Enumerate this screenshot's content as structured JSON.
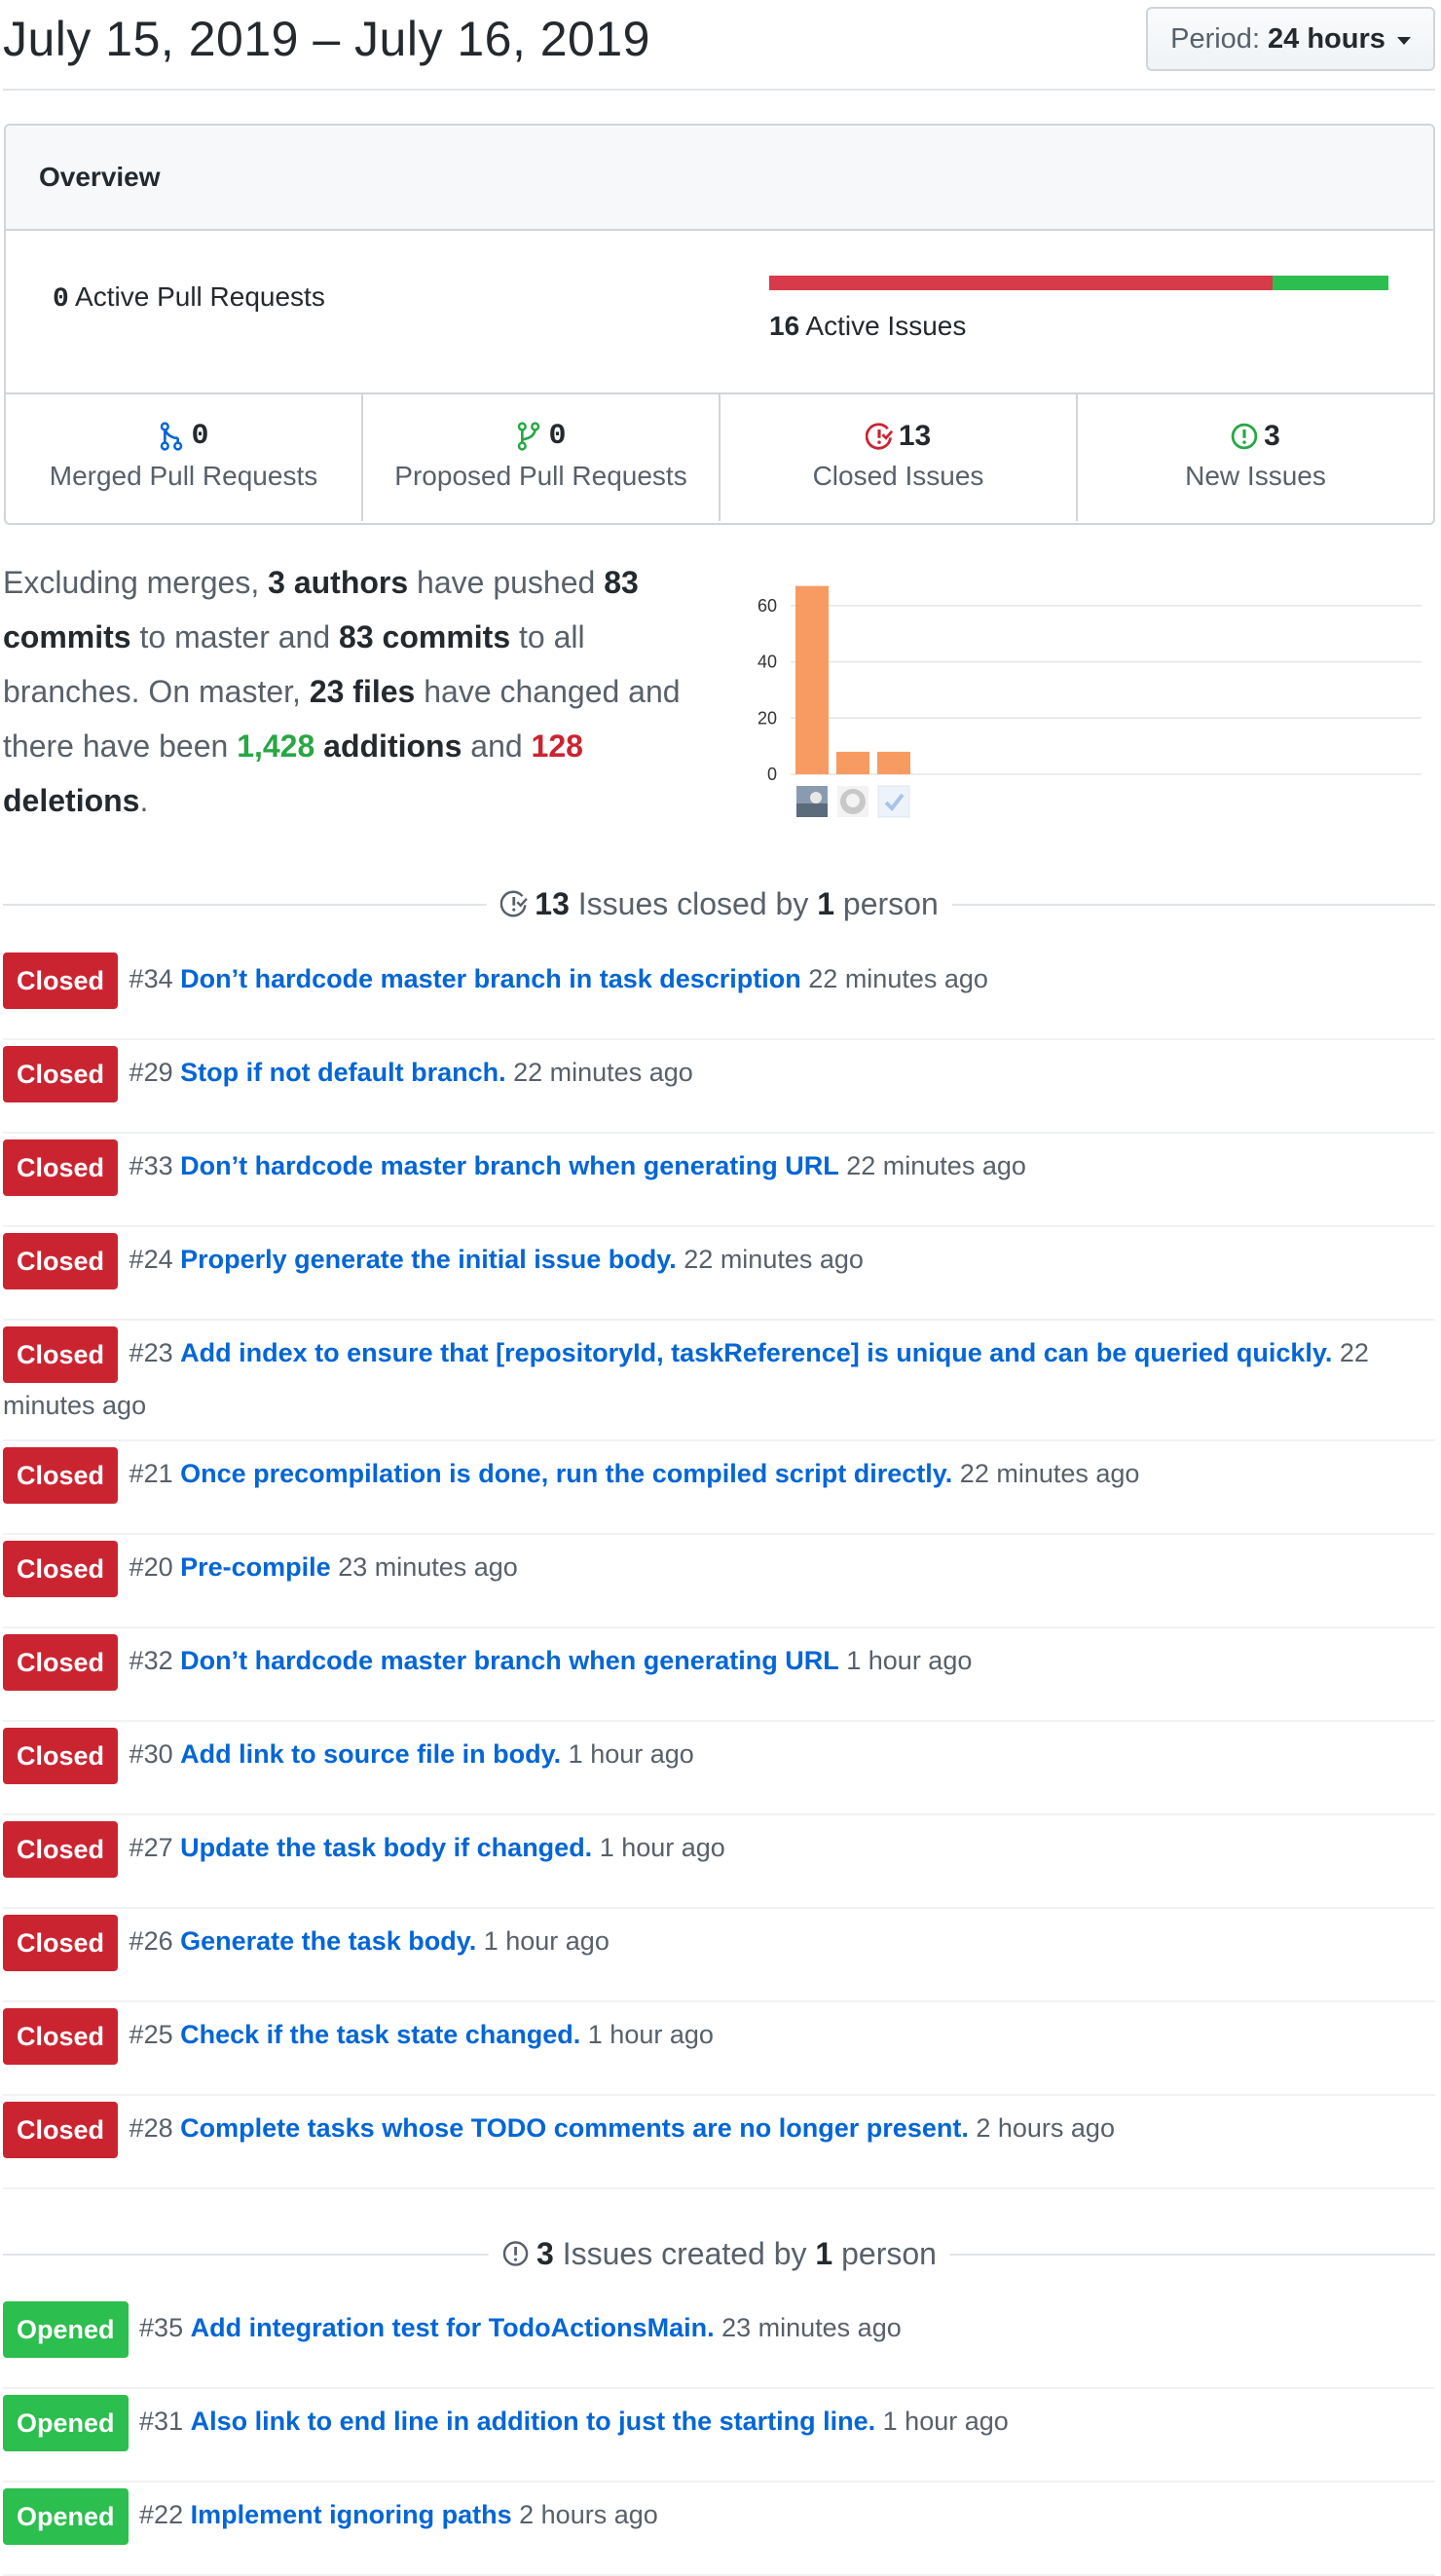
{
  "header": {
    "title": "July 15, 2019 – July 16, 2019",
    "period_label": "Period:",
    "period_value": "24 hours"
  },
  "overview": {
    "title": "Overview",
    "active_prs": {
      "count": "0",
      "label": "Active Pull Requests"
    },
    "active_issues": {
      "count": "16",
      "label": "Active Issues",
      "closed_fraction": 0.8125
    },
    "stats": [
      {
        "count": "0",
        "label": "Merged Pull Requests",
        "icon": "merged-pr-icon",
        "color": "#0366d6"
      },
      {
        "count": "0",
        "label": "Proposed Pull Requests",
        "icon": "proposed-pr-icon",
        "color": "#28a745"
      },
      {
        "count": "13",
        "label": "Closed Issues",
        "icon": "closed-issue-icon",
        "color": "#cb2431"
      },
      {
        "count": "3",
        "label": "New Issues",
        "icon": "new-issue-icon",
        "color": "#28a745"
      }
    ]
  },
  "summary": {
    "p1": "Excluding merges, ",
    "authors": "3 authors",
    "p2": " have pushed ",
    "commits_master": "83 commits",
    "p3": " to master and ",
    "commits_all": "83 commits",
    "p4": " to all branches. On master, ",
    "files": "23 files",
    "p5": " have changed and there have been ",
    "additions_num": "1,428",
    "additions_word": "additions",
    "p6": " and ",
    "deletions_num": "128",
    "deletions_word": "deletions",
    "p7": "."
  },
  "chart_data": {
    "type": "bar",
    "categories": [
      "author-1",
      "author-2",
      "author-3"
    ],
    "values": [
      67,
      8,
      8
    ],
    "yticks": [
      "0",
      "20",
      "40",
      "60"
    ],
    "ylim": [
      0,
      70
    ],
    "colors": {
      "bar": "#f89b62"
    },
    "x_tick_icons": [
      "avatar-photo-icon",
      "github-octocat-icon",
      "checkmark-icon"
    ]
  },
  "closed_section": {
    "count": "13",
    "text1": " Issues closed by ",
    "people": "1",
    "text2": " person"
  },
  "closed_issues": [
    {
      "badge": "Closed",
      "number": "#34",
      "title": "Don’t hardcode master branch in task description",
      "time": "22 minutes ago"
    },
    {
      "badge": "Closed",
      "number": "#29",
      "title": "Stop if not default branch.",
      "time": "22 minutes ago"
    },
    {
      "badge": "Closed",
      "number": "#33",
      "title": "Don’t hardcode master branch when generating URL",
      "time": "22 minutes ago"
    },
    {
      "badge": "Closed",
      "number": "#24",
      "title": "Properly generate the initial issue body.",
      "time": "22 minutes ago"
    },
    {
      "badge": "Closed",
      "number": "#23",
      "title": "Add index to ensure that [repositoryId, taskReference] is unique and can be queried quickly.",
      "time": "22 minutes ago"
    },
    {
      "badge": "Closed",
      "number": "#21",
      "title": "Once precompilation is done, run the compiled script directly.",
      "time": "22 minutes ago"
    },
    {
      "badge": "Closed",
      "number": "#20",
      "title": "Pre-compile",
      "time": "23 minutes ago"
    },
    {
      "badge": "Closed",
      "number": "#32",
      "title": "Don’t hardcode master branch when generating URL",
      "time": "1 hour ago"
    },
    {
      "badge": "Closed",
      "number": "#30",
      "title": "Add link to source file in body.",
      "time": "1 hour ago"
    },
    {
      "badge": "Closed",
      "number": "#27",
      "title": "Update the task body if changed.",
      "time": "1 hour ago"
    },
    {
      "badge": "Closed",
      "number": "#26",
      "title": "Generate the task body.",
      "time": "1 hour ago"
    },
    {
      "badge": "Closed",
      "number": "#25",
      "title": "Check if the task state changed.",
      "time": "1 hour ago"
    },
    {
      "badge": "Closed",
      "number": "#28",
      "title": "Complete tasks whose TODO comments are no longer present.",
      "time": "2 hours ago"
    }
  ],
  "opened_section": {
    "count": "3",
    "text1": " Issues created by ",
    "people": "1",
    "text2": " person"
  },
  "opened_issues": [
    {
      "badge": "Opened",
      "number": "#35",
      "title": "Add integration test for TodoActionsMain.",
      "time": "23 minutes ago"
    },
    {
      "badge": "Opened",
      "number": "#31",
      "title": "Also link to end line in addition to just the starting line.",
      "time": "1 hour ago"
    },
    {
      "badge": "Opened",
      "number": "#22",
      "title": "Implement ignoring paths",
      "time": "2 hours ago"
    }
  ]
}
